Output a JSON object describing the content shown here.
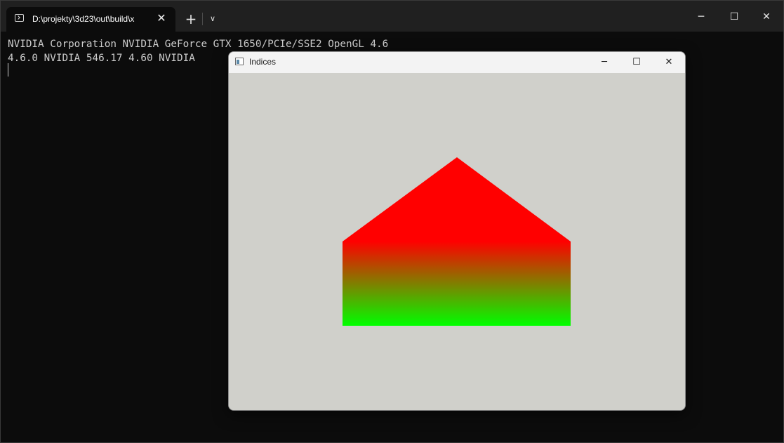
{
  "terminal": {
    "tab_title": "D:\\projekty\\3d23\\out\\build\\x",
    "new_tab_glyph": "+",
    "dropdown_glyph": "∨",
    "close_glyph": "✕",
    "minimize_glyph": "─",
    "maximize_glyph": "☐",
    "output_line1": "NVIDIA Corporation NVIDIA GeForce GTX 1650/PCIe/SSE2 OpenGL 4.6",
    "output_line2": "4.6.0 NVIDIA 546.17 4.60 NVIDIA"
  },
  "gl_window": {
    "title": "Indices",
    "minimize_glyph": "─",
    "maximize_glyph": "☐",
    "close_glyph": "✕",
    "clear_color": "#d0d0cb",
    "shape": {
      "name": "house",
      "top_color": "#ff0000",
      "bottom_color": "#00ff00"
    }
  }
}
